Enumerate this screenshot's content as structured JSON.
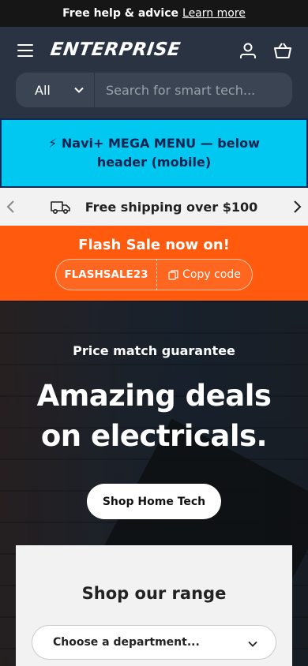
{
  "announcement": {
    "text": "Free help & advice",
    "link": "Learn more"
  },
  "header": {
    "logo": "ENTERPRISE",
    "menu_icon": "hamburger-menu-icon",
    "account_icon": "user-icon",
    "cart_icon": "basket-icon"
  },
  "search": {
    "category": "All",
    "placeholder": "Search for smart tech..."
  },
  "mega_menu": {
    "text": "⚡ Navi+ MEGA MENU — below header (mobile)"
  },
  "shipping": {
    "text": "Free shipping over $100",
    "icon": "truck-icon"
  },
  "flash_sale": {
    "title": "Flash Sale now on!",
    "code": "FLASHSALE23",
    "copy_label": "Copy code"
  },
  "hero": {
    "eyebrow": "Price match guarantee",
    "headline_line1": "Amazing deals",
    "headline_line2": "on electricals.",
    "cta": "Shop Home Tech"
  },
  "range": {
    "title": "Shop our range",
    "select_placeholder": "Choose a department..."
  },
  "colors": {
    "header_bg": "#2a3342",
    "mega_bg": "#00c8f0",
    "flash_bg": "#ff5a0d"
  }
}
